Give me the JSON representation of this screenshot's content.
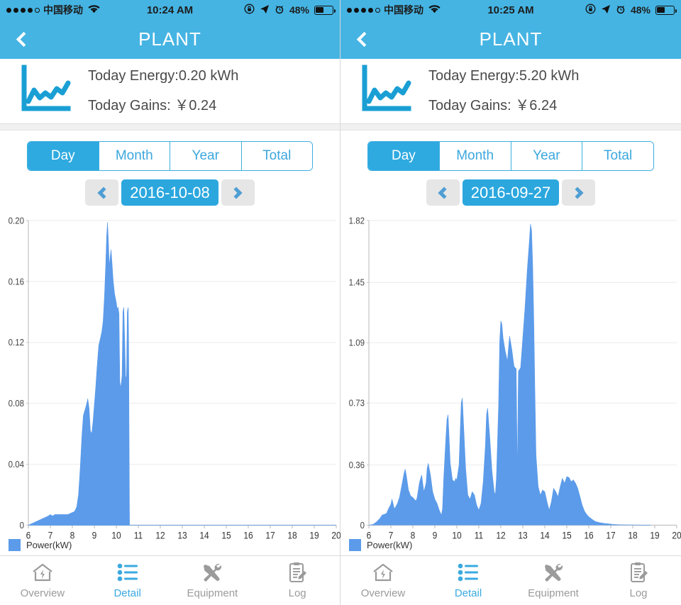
{
  "theme": {
    "header_blue": "#45b4e3",
    "accent_blue": "#2ba7de",
    "chart_fill": "#5b9bea",
    "inactive_gray": "#9b9b9b"
  },
  "panels": [
    {
      "statusbar": {
        "carrier": "中国移动",
        "time": "10:24 AM",
        "battery_pct": "48%",
        "signal_dots_filled": 4,
        "signal_dots_total": 5,
        "wifi_icon": "wifi-icon",
        "lock_icon": "rotation-lock-icon",
        "location_icon": "location-arrow-icon",
        "alarm_icon": "alarm-clock-icon",
        "battery_icon": "battery-icon"
      },
      "navbar": {
        "title": "PLANT",
        "back_icon": "back-chevron-icon"
      },
      "summary": {
        "icon": "line-chart-icon",
        "energy": "Today Energy:0.20 kWh",
        "gains": "Today Gains: ￥0.24"
      },
      "segments": [
        {
          "label": "Day",
          "active": true
        },
        {
          "label": "Month",
          "active": false
        },
        {
          "label": "Year",
          "active": false
        },
        {
          "label": "Total",
          "active": false
        }
      ],
      "date_nav": {
        "prev_icon": "chevron-left-icon",
        "next_icon": "chevron-right-icon",
        "value": "2016-10-08"
      },
      "chart_data": {
        "type": "area",
        "title": "",
        "xlabel": "",
        "ylabel": "",
        "legend": "Power(kW)",
        "legend_position": "bottom-left",
        "grid": true,
        "xlim": [
          6,
          20
        ],
        "ylim": [
          0,
          0.2
        ],
        "xticks": [
          6,
          7,
          8,
          9,
          10,
          11,
          12,
          13,
          14,
          15,
          16,
          17,
          18,
          19,
          20
        ],
        "yticks": [
          0,
          0.04,
          0.08,
          0.12,
          0.16,
          0.2
        ],
        "ytick_labels": [
          "0",
          "0.04",
          "0.08",
          "0.12",
          "0.16",
          "0.20"
        ],
        "series": [
          {
            "name": "Power(kW)",
            "color": "#5b9bea",
            "x": [
              6.0,
              6.15,
              6.3,
              6.45,
              6.6,
              6.75,
              6.9,
              7.0,
              7.1,
              7.2,
              7.35,
              7.5,
              7.65,
              7.8,
              7.95,
              8.1,
              8.2,
              8.28,
              8.36,
              8.44,
              8.5,
              8.58,
              8.64,
              8.7,
              8.76,
              8.82,
              8.88,
              8.94,
              9.0,
              9.06,
              9.12,
              9.2,
              9.28,
              9.34,
              9.4,
              9.46,
              9.52,
              9.56,
              9.6,
              9.64,
              9.68,
              9.72,
              9.76,
              9.8,
              9.86,
              9.92,
              9.96,
              10.0,
              10.04,
              10.08,
              10.12,
              10.16,
              10.2,
              10.26,
              10.3,
              10.34,
              10.38,
              10.42,
              10.46,
              10.5,
              10.54,
              10.56,
              10.58,
              10.6,
              11.0,
              12.0,
              13.0,
              14.0,
              15.0,
              16.0,
              17.0,
              18.0,
              19.0,
              20.0
            ],
            "y": [
              0.0,
              0.001,
              0.002,
              0.003,
              0.004,
              0.005,
              0.006,
              0.007,
              0.006,
              0.007,
              0.007,
              0.007,
              0.007,
              0.007,
              0.008,
              0.009,
              0.012,
              0.02,
              0.038,
              0.06,
              0.072,
              0.076,
              0.079,
              0.083,
              0.077,
              0.062,
              0.06,
              0.068,
              0.079,
              0.09,
              0.103,
              0.118,
              0.123,
              0.127,
              0.134,
              0.15,
              0.172,
              0.19,
              0.199,
              0.186,
              0.17,
              0.176,
              0.181,
              0.173,
              0.16,
              0.152,
              0.149,
              0.146,
              0.142,
              0.143,
              0.139,
              0.094,
              0.09,
              0.098,
              0.14,
              0.143,
              0.122,
              0.098,
              0.096,
              0.14,
              0.143,
              0.12,
              0.06,
              0.0,
              0.0,
              0.0,
              0.0,
              0.0,
              0.0,
              0.0,
              0.0,
              0.0,
              0.0,
              0.0
            ]
          }
        ]
      },
      "tabs": [
        {
          "label": "Overview",
          "icon": "home-energy-icon",
          "active": false
        },
        {
          "label": "Detail",
          "icon": "list-icon",
          "active": true
        },
        {
          "label": "Equipment",
          "icon": "tools-icon",
          "active": false
        },
        {
          "label": "Log",
          "icon": "clipboard-icon",
          "active": false
        }
      ]
    },
    {
      "statusbar": {
        "carrier": "中国移动",
        "time": "10:25 AM",
        "battery_pct": "48%",
        "signal_dots_filled": 4,
        "signal_dots_total": 5,
        "wifi_icon": "wifi-icon",
        "lock_icon": "rotation-lock-icon",
        "location_icon": "location-arrow-icon",
        "alarm_icon": "alarm-clock-icon",
        "battery_icon": "battery-icon"
      },
      "navbar": {
        "title": "PLANT",
        "back_icon": "back-chevron-icon"
      },
      "summary": {
        "icon": "line-chart-icon",
        "energy": "Today Energy:5.20 kWh",
        "gains": "Today Gains: ￥6.24"
      },
      "segments": [
        {
          "label": "Day",
          "active": true
        },
        {
          "label": "Month",
          "active": false
        },
        {
          "label": "Year",
          "active": false
        },
        {
          "label": "Total",
          "active": false
        }
      ],
      "date_nav": {
        "prev_icon": "chevron-left-icon",
        "next_icon": "chevron-right-icon",
        "value": "2016-09-27"
      },
      "chart_data": {
        "type": "area",
        "title": "",
        "xlabel": "",
        "ylabel": "",
        "legend": "Power(kW)",
        "legend_position": "bottom-left",
        "grid": true,
        "xlim": [
          6,
          20
        ],
        "ylim": [
          0,
          1.82
        ],
        "xticks": [
          6,
          7,
          8,
          9,
          10,
          11,
          12,
          13,
          14,
          15,
          16,
          17,
          18,
          19,
          20
        ],
        "yticks": [
          0,
          0.36,
          0.73,
          1.09,
          1.45,
          1.82
        ],
        "ytick_labels": [
          "0",
          "0.36",
          "0.73",
          "1.09",
          "1.45",
          "1.82"
        ],
        "series": [
          {
            "name": "Power(kW)",
            "color": "#5b9bea",
            "x": [
              6.0,
              6.2,
              6.35,
              6.5,
              6.6,
              6.7,
              6.8,
              6.9,
              7.0,
              7.05,
              7.1,
              7.15,
              7.2,
              7.3,
              7.4,
              7.5,
              7.6,
              7.65,
              7.7,
              7.8,
              7.9,
              8.0,
              8.1,
              8.15,
              8.2,
              8.3,
              8.4,
              8.5,
              8.6,
              8.65,
              8.7,
              8.8,
              8.9,
              9.0,
              9.1,
              9.2,
              9.3,
              9.35,
              9.4,
              9.5,
              9.55,
              9.6,
              9.65,
              9.7,
              9.8,
              9.9,
              9.95,
              10.0,
              10.1,
              10.15,
              10.2,
              10.25,
              10.3,
              10.4,
              10.5,
              10.6,
              10.7,
              10.8,
              10.9,
              11.0,
              11.1,
              11.2,
              11.3,
              11.35,
              11.4,
              11.5,
              11.6,
              11.7,
              11.75,
              11.8,
              11.9,
              11.95,
              12.0,
              12.05,
              12.1,
              12.2,
              12.3,
              12.35,
              12.4,
              12.5,
              12.6,
              12.65,
              12.7,
              12.75,
              12.8,
              12.9,
              13.0,
              13.1,
              13.2,
              13.3,
              13.35,
              13.4,
              13.45,
              13.5,
              13.55,
              13.6,
              13.7,
              13.8,
              13.9,
              14.0,
              14.1,
              14.2,
              14.3,
              14.4,
              14.5,
              14.6,
              14.7,
              14.8,
              14.9,
              15.0,
              15.1,
              15.2,
              15.3,
              15.4,
              15.5,
              15.6,
              15.7,
              15.8,
              15.9,
              16.0,
              16.1,
              16.2,
              16.3,
              16.5,
              16.7,
              16.9,
              17.1,
              17.4,
              17.8,
              18.2,
              18.8,
              19.4,
              20.0
            ],
            "y": [
              0.0,
              0.005,
              0.02,
              0.04,
              0.06,
              0.065,
              0.07,
              0.1,
              0.125,
              0.155,
              0.13,
              0.1,
              0.105,
              0.13,
              0.17,
              0.24,
              0.31,
              0.335,
              0.3,
              0.21,
              0.175,
              0.165,
              0.15,
              0.145,
              0.17,
              0.255,
              0.3,
              0.2,
              0.25,
              0.34,
              0.37,
              0.3,
              0.2,
              0.155,
              0.13,
              0.09,
              0.06,
              0.1,
              0.27,
              0.52,
              0.63,
              0.66,
              0.52,
              0.37,
              0.27,
              0.26,
              0.28,
              0.27,
              0.36,
              0.55,
              0.73,
              0.76,
              0.62,
              0.34,
              0.18,
              0.155,
              0.2,
              0.18,
              0.12,
              0.09,
              0.13,
              0.26,
              0.48,
              0.66,
              0.7,
              0.52,
              0.32,
              0.2,
              0.18,
              0.28,
              0.72,
              1.1,
              1.22,
              1.2,
              1.12,
              1.04,
              0.98,
              1.06,
              1.13,
              1.05,
              0.95,
              0.94,
              0.935,
              0.3,
              0.92,
              0.94,
              1.12,
              1.3,
              1.52,
              1.7,
              1.8,
              1.76,
              1.55,
              1.22,
              0.8,
              0.42,
              0.23,
              0.18,
              0.21,
              0.2,
              0.14,
              0.09,
              0.14,
              0.22,
              0.2,
              0.17,
              0.23,
              0.28,
              0.25,
              0.29,
              0.285,
              0.26,
              0.27,
              0.25,
              0.22,
              0.17,
              0.12,
              0.085,
              0.065,
              0.05,
              0.04,
              0.03,
              0.022,
              0.015,
              0.011,
              0.008,
              0.005,
              0.003,
              0.002,
              0.001,
              0.0
            ]
          }
        ]
      },
      "tabs": [
        {
          "label": "Overview",
          "icon": "home-energy-icon",
          "active": false
        },
        {
          "label": "Detail",
          "icon": "list-icon",
          "active": true
        },
        {
          "label": "Equipment",
          "icon": "tools-icon",
          "active": false
        },
        {
          "label": "Log",
          "icon": "clipboard-icon",
          "active": false
        }
      ]
    }
  ]
}
